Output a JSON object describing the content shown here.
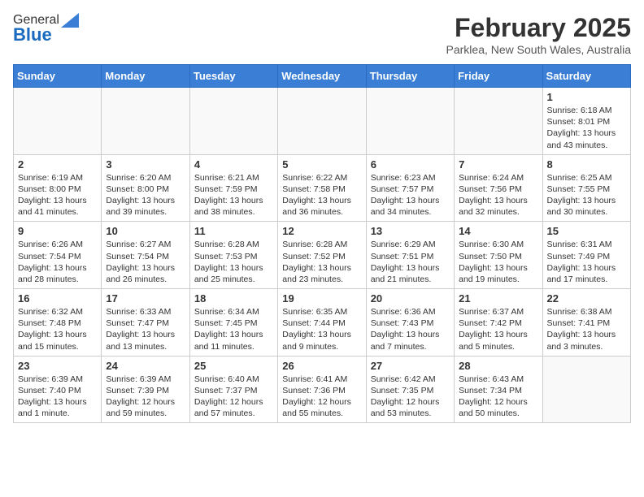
{
  "header": {
    "logo_general": "General",
    "logo_blue": "Blue",
    "month_year": "February 2025",
    "location": "Parklea, New South Wales, Australia"
  },
  "calendar": {
    "days_of_week": [
      "Sunday",
      "Monday",
      "Tuesday",
      "Wednesday",
      "Thursday",
      "Friday",
      "Saturday"
    ],
    "weeks": [
      [
        {
          "day": "",
          "info": ""
        },
        {
          "day": "",
          "info": ""
        },
        {
          "day": "",
          "info": ""
        },
        {
          "day": "",
          "info": ""
        },
        {
          "day": "",
          "info": ""
        },
        {
          "day": "",
          "info": ""
        },
        {
          "day": "1",
          "info": "Sunrise: 6:18 AM\nSunset: 8:01 PM\nDaylight: 13 hours\nand 43 minutes."
        }
      ],
      [
        {
          "day": "2",
          "info": "Sunrise: 6:19 AM\nSunset: 8:00 PM\nDaylight: 13 hours\nand 41 minutes."
        },
        {
          "day": "3",
          "info": "Sunrise: 6:20 AM\nSunset: 8:00 PM\nDaylight: 13 hours\nand 39 minutes."
        },
        {
          "day": "4",
          "info": "Sunrise: 6:21 AM\nSunset: 7:59 PM\nDaylight: 13 hours\nand 38 minutes."
        },
        {
          "day": "5",
          "info": "Sunrise: 6:22 AM\nSunset: 7:58 PM\nDaylight: 13 hours\nand 36 minutes."
        },
        {
          "day": "6",
          "info": "Sunrise: 6:23 AM\nSunset: 7:57 PM\nDaylight: 13 hours\nand 34 minutes."
        },
        {
          "day": "7",
          "info": "Sunrise: 6:24 AM\nSunset: 7:56 PM\nDaylight: 13 hours\nand 32 minutes."
        },
        {
          "day": "8",
          "info": "Sunrise: 6:25 AM\nSunset: 7:55 PM\nDaylight: 13 hours\nand 30 minutes."
        }
      ],
      [
        {
          "day": "9",
          "info": "Sunrise: 6:26 AM\nSunset: 7:54 PM\nDaylight: 13 hours\nand 28 minutes."
        },
        {
          "day": "10",
          "info": "Sunrise: 6:27 AM\nSunset: 7:54 PM\nDaylight: 13 hours\nand 26 minutes."
        },
        {
          "day": "11",
          "info": "Sunrise: 6:28 AM\nSunset: 7:53 PM\nDaylight: 13 hours\nand 25 minutes."
        },
        {
          "day": "12",
          "info": "Sunrise: 6:28 AM\nSunset: 7:52 PM\nDaylight: 13 hours\nand 23 minutes."
        },
        {
          "day": "13",
          "info": "Sunrise: 6:29 AM\nSunset: 7:51 PM\nDaylight: 13 hours\nand 21 minutes."
        },
        {
          "day": "14",
          "info": "Sunrise: 6:30 AM\nSunset: 7:50 PM\nDaylight: 13 hours\nand 19 minutes."
        },
        {
          "day": "15",
          "info": "Sunrise: 6:31 AM\nSunset: 7:49 PM\nDaylight: 13 hours\nand 17 minutes."
        }
      ],
      [
        {
          "day": "16",
          "info": "Sunrise: 6:32 AM\nSunset: 7:48 PM\nDaylight: 13 hours\nand 15 minutes."
        },
        {
          "day": "17",
          "info": "Sunrise: 6:33 AM\nSunset: 7:47 PM\nDaylight: 13 hours\nand 13 minutes."
        },
        {
          "day": "18",
          "info": "Sunrise: 6:34 AM\nSunset: 7:45 PM\nDaylight: 13 hours\nand 11 minutes."
        },
        {
          "day": "19",
          "info": "Sunrise: 6:35 AM\nSunset: 7:44 PM\nDaylight: 13 hours\nand 9 minutes."
        },
        {
          "day": "20",
          "info": "Sunrise: 6:36 AM\nSunset: 7:43 PM\nDaylight: 13 hours\nand 7 minutes."
        },
        {
          "day": "21",
          "info": "Sunrise: 6:37 AM\nSunset: 7:42 PM\nDaylight: 13 hours\nand 5 minutes."
        },
        {
          "day": "22",
          "info": "Sunrise: 6:38 AM\nSunset: 7:41 PM\nDaylight: 13 hours\nand 3 minutes."
        }
      ],
      [
        {
          "day": "23",
          "info": "Sunrise: 6:39 AM\nSunset: 7:40 PM\nDaylight: 13 hours\nand 1 minute."
        },
        {
          "day": "24",
          "info": "Sunrise: 6:39 AM\nSunset: 7:39 PM\nDaylight: 12 hours\nand 59 minutes."
        },
        {
          "day": "25",
          "info": "Sunrise: 6:40 AM\nSunset: 7:37 PM\nDaylight: 12 hours\nand 57 minutes."
        },
        {
          "day": "26",
          "info": "Sunrise: 6:41 AM\nSunset: 7:36 PM\nDaylight: 12 hours\nand 55 minutes."
        },
        {
          "day": "27",
          "info": "Sunrise: 6:42 AM\nSunset: 7:35 PM\nDaylight: 12 hours\nand 53 minutes."
        },
        {
          "day": "28",
          "info": "Sunrise: 6:43 AM\nSunset: 7:34 PM\nDaylight: 12 hours\nand 50 minutes."
        },
        {
          "day": "",
          "info": ""
        }
      ]
    ]
  }
}
